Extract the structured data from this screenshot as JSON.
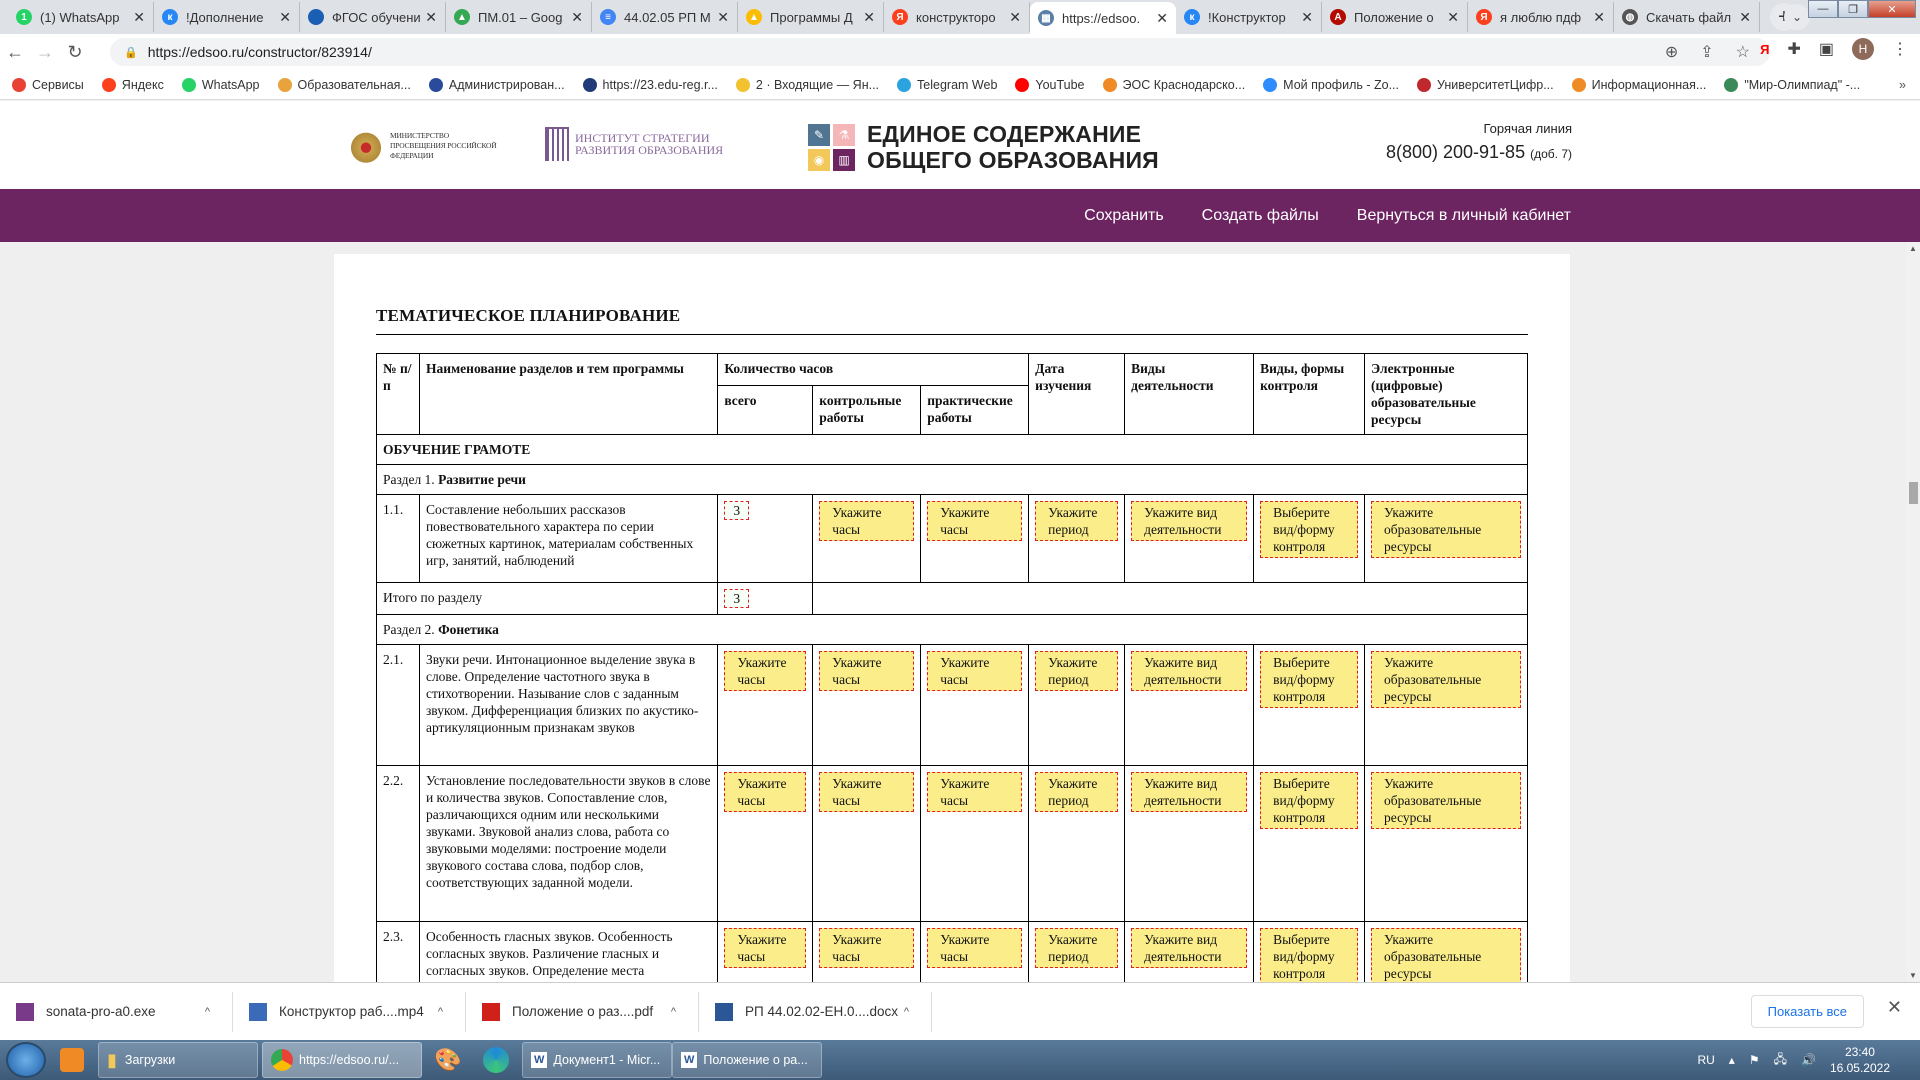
{
  "browser": {
    "tabs": [
      {
        "title": "(1) WhatsApp",
        "icon": "whatsapp-icon",
        "color": "#25d366",
        "glyph": "1"
      },
      {
        "title": "!Дополнение",
        "icon": "vk-icon",
        "color": "#2787f5",
        "glyph": "к"
      },
      {
        "title": "ФГОС обучени",
        "icon": "fgos-icon",
        "color": "#1a5fb4",
        "glyph": ""
      },
      {
        "title": "ПМ.01 – Goog",
        "icon": "google-drive-icon",
        "color": "#34a853",
        "glyph": "▲"
      },
      {
        "title": "44.02.05 РП М",
        "icon": "google-docs-icon",
        "color": "#4285f4",
        "glyph": "≡"
      },
      {
        "title": "Программы Д",
        "icon": "google-drive-icon",
        "color": "#fbbc04",
        "glyph": "▲"
      },
      {
        "title": "конструкторо",
        "icon": "yandex-icon",
        "color": "#fc3f1d",
        "glyph": "Я"
      },
      {
        "title": "https://edsoo.",
        "icon": "edsoo-icon",
        "color": "#5b7fa6",
        "glyph": "▦",
        "active": true
      },
      {
        "title": "!Конструктор",
        "icon": "vk-icon",
        "color": "#2787f5",
        "glyph": "к"
      },
      {
        "title": "Положение о",
        "icon": "acrobat-icon",
        "color": "#b30b00",
        "glyph": "A"
      },
      {
        "title": "я люблю пдф",
        "icon": "yandex-icon",
        "color": "#fc3f1d",
        "glyph": "Я"
      },
      {
        "title": "Скачать файл",
        "icon": "globe-icon",
        "color": "#555555",
        "glyph": "◍"
      }
    ],
    "url": "https://edsoo.ru/constructor/823914/",
    "bookmarks": [
      {
        "label": "Сервисы",
        "color": "#e94235"
      },
      {
        "label": "Яндекс",
        "color": "#fc3f1d"
      },
      {
        "label": "WhatsApp",
        "color": "#25d366"
      },
      {
        "label": "Образовательная...",
        "color": "#e8a33c"
      },
      {
        "label": "Администрирован...",
        "color": "#2a4a9a"
      },
      {
        "label": "https://23.edu-reg.r...",
        "color": "#203a7a"
      },
      {
        "label": "2 · Входящие — Ян...",
        "color": "#f2c230"
      },
      {
        "label": "Telegram Web",
        "color": "#2aa3df"
      },
      {
        "label": "YouTube",
        "color": "#ff0000"
      },
      {
        "label": "ЭОС Краснодарско...",
        "color": "#f08a24"
      },
      {
        "label": "Мой профиль - Zo...",
        "color": "#2d8cff"
      },
      {
        "label": "УниверситетЦифр...",
        "color": "#c0282d"
      },
      {
        "label": "Информационная...",
        "color": "#f08a24"
      },
      {
        "label": "\"Мир-Олимпиад\" -...",
        "color": "#3a8a5a"
      }
    ],
    "profile_initial": "Н"
  },
  "site": {
    "ministry": "МИНИСТЕРСТВО ПРОСВЕЩЕНИЯ РОССИЙСКОЙ ФЕДЕРАЦИИ",
    "institute_l1": "ИНСТИТУТ СТРАТЕГИИ",
    "institute_l2": "РАЗВИТИЯ ОБРАЗОВАНИЯ",
    "brand_l1": "ЕДИНОЕ СОДЕРЖАНИЕ",
    "brand_l2": "ОБЩЕГО ОБРАЗОВАНИЯ",
    "hotline_label": "Горячая линия",
    "hotline_phone": "8(800) 200-91-85",
    "hotline_ext": "(доб. 7)",
    "menu": {
      "save": "Сохранить",
      "create_files": "Создать файлы",
      "back": "Вернуться в личный кабинет"
    },
    "accent": "#6d2562"
  },
  "doc": {
    "title": "ТЕМАТИЧЕСКОЕ ПЛАНИРОВАНИЕ",
    "headers": {
      "num": "№ п/п",
      "name": "Наименование разделов и тем программы",
      "hours": "Количество часов",
      "total": "всего",
      "control": "контрольные работы",
      "practical": "практические работы",
      "date": "Дата изучения",
      "activities": "Виды деятельности",
      "forms": "Виды, формы контроля",
      "resources": "Электронные (цифровые) образовательные ресурсы"
    },
    "placeholders": {
      "hours": "Укажите часы",
      "period": "Укажите период",
      "activity": "Укажите вид деятельности",
      "control": "Выберите вид/форму контроля",
      "resources": "Укажите образовательные ресурсы"
    },
    "block_title": "ОБУЧЕНИЕ ГРАМОТЕ",
    "section1": {
      "prefix": "Раздел 1.",
      "name": "Развитие речи"
    },
    "row11": {
      "num": "1.1.",
      "text": "Составление небольших рассказов повествовательного характера по серии сюжетных картинок, материалам собственных игр, занятий, наблюдений",
      "total": "3"
    },
    "subtotal": {
      "label": "Итого по разделу",
      "value": "3"
    },
    "section2": {
      "prefix": "Раздел 2.",
      "name": "Фонетика"
    },
    "row21": {
      "num": "2.1.",
      "text": "Звуки речи. Интонационное выделение звука в слове. Определение частотного звука в стихотворении. Называние слов с заданным звуком. Дифференциация близких по акустико-артикуляционным признакам звуков"
    },
    "row22": {
      "num": "2.2.",
      "text": "Установление последовательности звуков в слове и количества звуков. Сопоставление слов, различающихся одним или несколькими звуками. Звуковой анализ слова, работа со звуковыми моделями: построение модели звукового состава слова, подбор слов, соответствующих заданной модели."
    },
    "row23": {
      "num": "2.3.",
      "text": "Особенность гласных звуков. Особенность согласных звуков. Различение гласных и согласных звуков. Определение места"
    }
  },
  "downloads": {
    "items": [
      {
        "name": "sonata-pro-a0.exe",
        "icon": "winrar-icon"
      },
      {
        "name": "Конструктор раб....mp4",
        "icon": "video-file-icon"
      },
      {
        "name": "Положение о раз....pdf",
        "icon": "pdf-file-icon"
      },
      {
        "name": "РП 44.02.02-ЕН.0....docx",
        "icon": "word-file-icon"
      }
    ],
    "show_all": "Показать все"
  },
  "taskbar": {
    "items": [
      "Загрузки",
      "https://edsoo.ru/...",
      "Документ1 - Micr...",
      "Положение о ра..."
    ],
    "lang": "RU",
    "time": "23:40",
    "date": "16.05.2022"
  }
}
